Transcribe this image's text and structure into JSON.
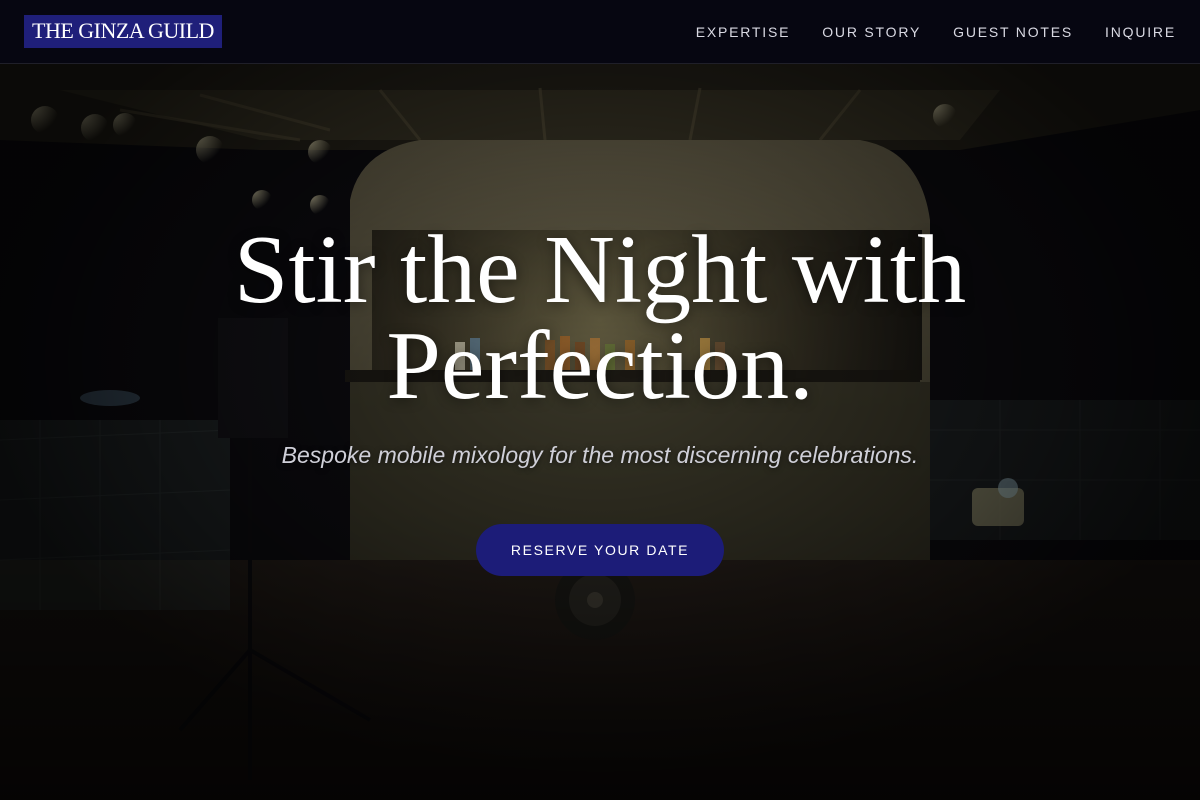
{
  "brand": {
    "logo_text": "THE GINZA GUILD",
    "logo_bg": "#1f1f7a"
  },
  "nav": {
    "items": [
      {
        "label": "EXPERTISE"
      },
      {
        "label": "OUR STORY"
      },
      {
        "label": "GUEST NOTES"
      },
      {
        "label": "INQUIRE"
      }
    ]
  },
  "hero": {
    "title": "Stir the Night with Perfection.",
    "subtitle": "Bespoke mobile mixology for the most discerning celebrations.",
    "cta_label": "RESERVE YOUR DATE",
    "cta_color": "#1c1c78",
    "background_image": "night-trailer-bar-photo"
  }
}
